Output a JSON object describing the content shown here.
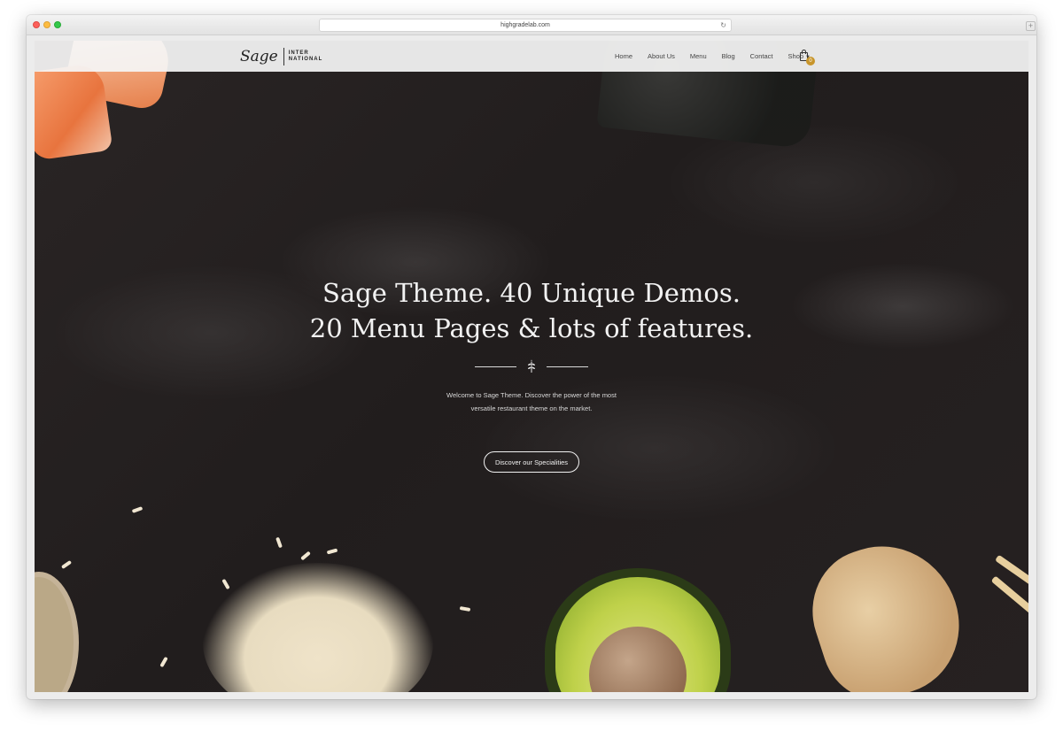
{
  "browser": {
    "url": "highgradelab.com"
  },
  "site": {
    "logo": {
      "script": "Sage",
      "sub_line1": "INTER",
      "sub_line2": "NATIONAL"
    },
    "nav": {
      "items": [
        {
          "label": "Home"
        },
        {
          "label": "About Us"
        },
        {
          "label": "Menu"
        },
        {
          "label": "Blog"
        },
        {
          "label": "Contact"
        },
        {
          "label": "Shop"
        }
      ],
      "cart_count": "0"
    },
    "hero": {
      "title_line1": "Sage Theme. 40 Unique Demos.",
      "title_line2": "20 Menu Pages & lots of features.",
      "desc_line1": "Welcome to Sage Theme. Discover the power of the most",
      "desc_line2": "versatile restaurant theme on the market.",
      "cta_label": "Discover our Specialities"
    }
  },
  "colors": {
    "background_dark": "#221e1e",
    "header_bg": "#f5f5f5",
    "cart_badge": "#c8952a",
    "text_light": "#f2f2f2"
  },
  "icons": [
    "reload-icon",
    "new-tab-icon",
    "cart-icon",
    "caret-down-icon",
    "leaf-icon"
  ]
}
